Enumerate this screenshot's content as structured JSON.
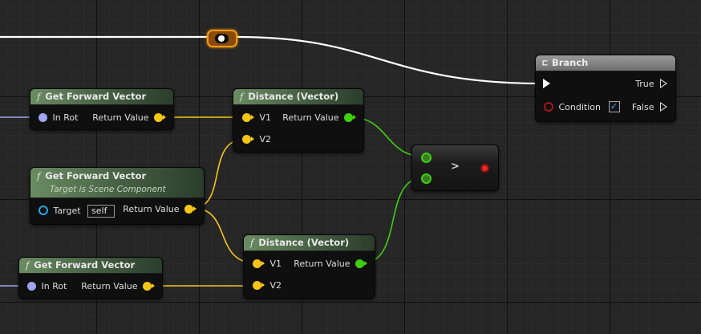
{
  "nodes": {
    "branch": {
      "title": "Branch",
      "icon": "branch-icon",
      "true_label": "True",
      "condition_label": "Condition",
      "false_label": "False",
      "condition_checked": "✓"
    },
    "gfv_top": {
      "title": "Get Forward Vector",
      "in_label": "In Rot",
      "out_label": "Return Value"
    },
    "gfv_mid": {
      "title": "Get Forward Vector",
      "subtitle": "Target is Scene Component",
      "target_label": "Target",
      "target_value": "self",
      "out_label": "Return Value"
    },
    "gfv_bottom": {
      "title": "Get Forward Vector",
      "in_label": "In Rot",
      "out_label": "Return Value"
    },
    "dist_top": {
      "title": "Distance (Vector)",
      "v1_label": "V1",
      "v2_label": "V2",
      "out_label": "Return Value"
    },
    "dist_bottom": {
      "title": "Distance (Vector)",
      "v1_label": "V1",
      "v2_label": "V2",
      "out_label": "Return Value"
    },
    "compare": {
      "operator": ">"
    }
  },
  "colors": {
    "exec_wire": "#ffffff",
    "vector_pin": "#f5c518",
    "float_pin": "#3fcf12",
    "rotator_pin": "#9ea5ee",
    "bool_pin": "#e02a2a",
    "reroute_highlight": "#f19a12"
  }
}
